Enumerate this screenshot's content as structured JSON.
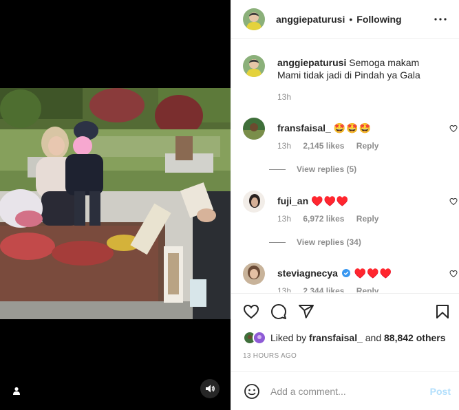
{
  "post": {
    "author": "anggiepaturusi",
    "follow_label": "Following",
    "dot": "•",
    "caption": "Semoga makam Mami tidak jadi di Pindah ya Gala",
    "caption_time": "13h",
    "more_icon": "more-horizontal-icon"
  },
  "comments": [
    {
      "user": "fransfaisal_",
      "text": "🤩🤩🤩",
      "time": "13h",
      "likes": "2,145 likes",
      "reply_label": "Reply",
      "view_replies": "View replies (5)"
    },
    {
      "user": "fuji_an",
      "text": "♥️♥️♥️",
      "time": "13h",
      "likes": "6,972 likes",
      "reply_label": "Reply",
      "view_replies": "View replies (34)"
    },
    {
      "user": "steviagnecya",
      "text": "♥️♥️♥️",
      "verified": true,
      "time": "13h",
      "likes": "2,344 likes",
      "reply_label": "Reply"
    }
  ],
  "likes_summary": {
    "prefix": "Liked by",
    "user": "fransfaisal_",
    "middle": "and",
    "count": "88,842 others"
  },
  "timestamp": "13 HOURS AGO",
  "add_comment": {
    "placeholder": "Add a comment...",
    "post_label": "Post"
  },
  "colors": {
    "text": "#262626",
    "secondary": "#8e8e8e",
    "post_disabled": "#b2dffc",
    "verified": "#3897f0",
    "heart": "#ed4956"
  },
  "icons": {
    "like": "heart-icon",
    "comment": "comment-icon",
    "share": "paper-plane-icon",
    "save": "bookmark-icon",
    "emoji": "smiley-icon",
    "tag": "user-tag-icon",
    "audio": "speaker-icon"
  }
}
